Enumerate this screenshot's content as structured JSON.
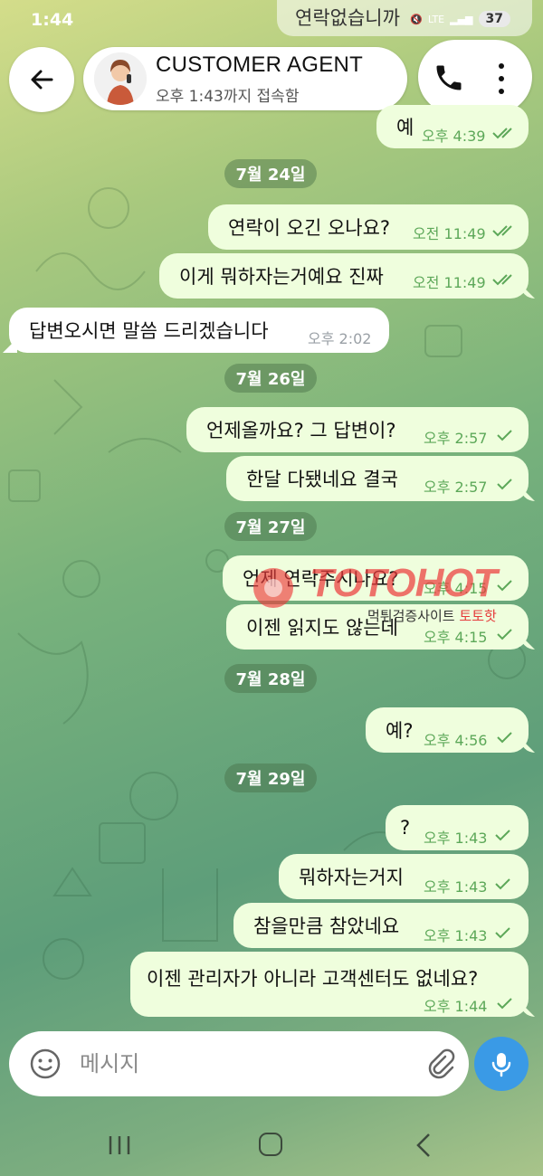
{
  "status_bar": {
    "time": "1:44",
    "network": "LTE",
    "battery": "37"
  },
  "ghost_banner": "연락없습니까",
  "header": {
    "name": "CUSTOMER AGENT",
    "last_seen": "오후 1:43까지 접속함"
  },
  "messages": [
    {
      "dir": "out",
      "text": "예",
      "time": "오후 4:39",
      "read": true
    },
    {
      "dir": "out",
      "text": "연락이 오긴 오나요?",
      "time": "오전 11:49",
      "read": true
    },
    {
      "dir": "out",
      "text": "이게 뭐하자는거예요 진짜",
      "time": "오전 11:49",
      "read": true
    },
    {
      "dir": "in",
      "text": "답변오시면 말씀 드리겠습니다",
      "time": "오후 2:02"
    },
    {
      "dir": "out",
      "text": "언제올까요? 그 답변이?",
      "time": "오후 2:57",
      "read": false
    },
    {
      "dir": "out",
      "text": "한달 다됐네요 결국",
      "time": "오후 2:57",
      "read": false
    },
    {
      "dir": "out",
      "text": "언제 연락주시나요?",
      "time": "오후 4:15",
      "read": false
    },
    {
      "dir": "out",
      "text": "이젠 읽지도 않는데",
      "time": "오후 4:15",
      "read": false
    },
    {
      "dir": "out",
      "text": "예?",
      "time": "오후 4:56",
      "read": false
    },
    {
      "dir": "out",
      "text": "?",
      "time": "오후 1:43",
      "read": false
    },
    {
      "dir": "out",
      "text": "뭐하자는거지",
      "time": "오후 1:43",
      "read": false
    },
    {
      "dir": "out",
      "text": "참을만큼 참았네요",
      "time": "오후 1:43",
      "read": false
    },
    {
      "dir": "out",
      "text": "이젠 관리자가 아니라 고객센터도 없네요?",
      "time": "오후 1:44",
      "read": false
    }
  ],
  "dates": [
    "7월 24일",
    "7월 26일",
    "7월 27일",
    "7월 28일",
    "7월 29일"
  ],
  "watermark": {
    "brand": "TOTOHOT",
    "sub_prefix": "먹튀검증사이트",
    "sub_brand": "토토핫"
  },
  "composer": {
    "placeholder": "메시지"
  },
  "colors": {
    "outgoing_bubble": "#effedd",
    "incoming_bubble": "#ffffff",
    "tick": "#5da859",
    "mic": "#3a9ae6"
  }
}
